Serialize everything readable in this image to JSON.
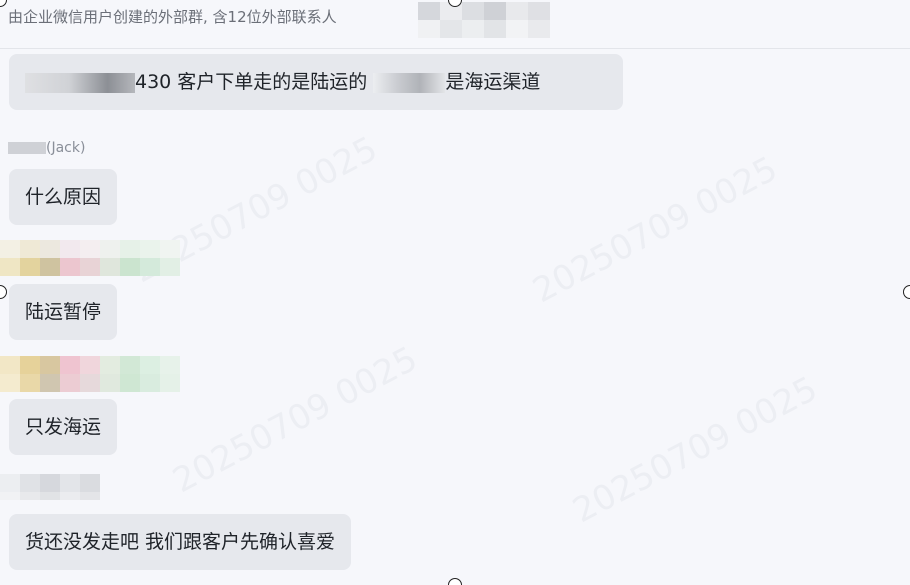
{
  "header": {
    "description": "由企业微信用户创建的外部群, 含12位外部联系人"
  },
  "messages": [
    {
      "text_visible": "430  客户下单走的是陆运的",
      "text_tail": "是海运渠道"
    },
    {
      "sender": "(Jack)",
      "text": "什么原因"
    },
    {
      "text": "陆运暂停"
    },
    {
      "text": "只发海运"
    },
    {
      "text": "货还没发走吧  我们跟客户先确认喜爱"
    }
  ],
  "watermark": {
    "text": "20250709 0025"
  }
}
